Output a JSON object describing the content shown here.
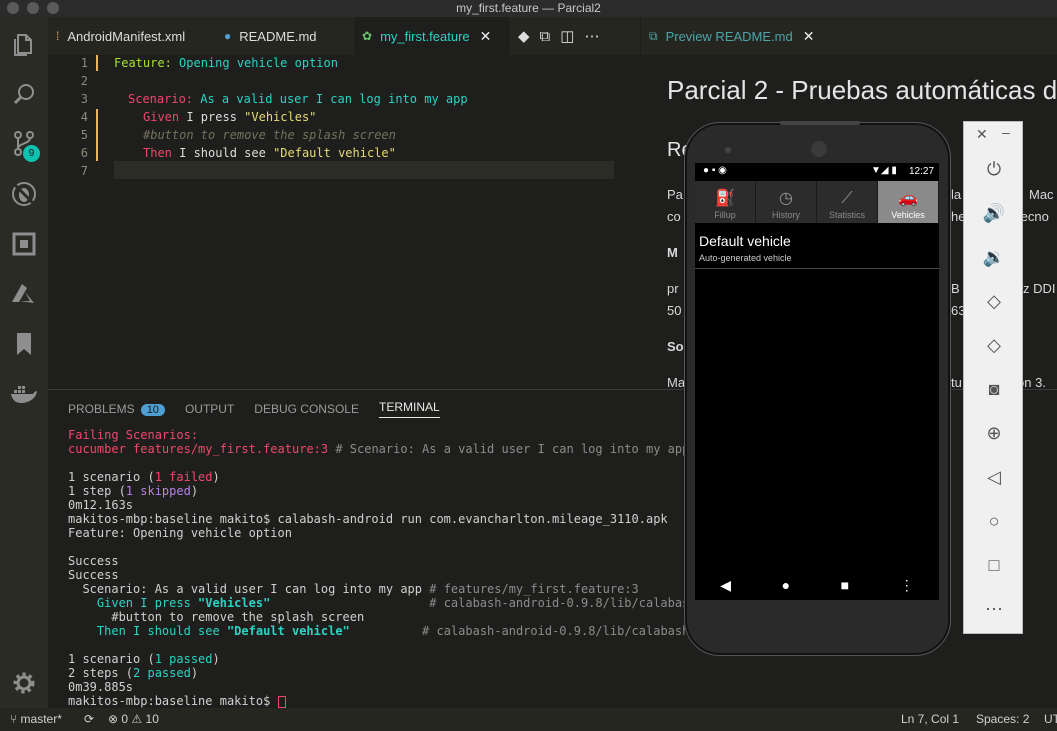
{
  "window": {
    "title": "my_first.feature — Parcial2"
  },
  "activity_bar": {
    "scm_badge": "9"
  },
  "tabs": [
    {
      "label": "AndroidManifest.xml"
    },
    {
      "label": "README.md"
    },
    {
      "label": "my_first.feature"
    }
  ],
  "preview_tab": {
    "label": "Preview README.md"
  },
  "editor": {
    "line_numbers": [
      "1",
      "2",
      "3",
      "4",
      "5",
      "6",
      "7"
    ],
    "lines": {
      "l1_kw": "Feature:",
      "l1_text": " Opening vehicle option",
      "l3_kw": "Scenario:",
      "l3_text": " As a valid user I can log into my app",
      "l4_kw": "Given",
      "l4_text": " I press ",
      "l4_str": "\"Vehicles\"",
      "l5_comment": "#button to remove the splash screen",
      "l6_kw": "Then",
      "l6_text": " I should see ",
      "l6_str": "\"Default vehicle\""
    }
  },
  "preview": {
    "h1": "Parcial 2 - Pruebas automáticas d",
    "h2": "Re",
    "p1a": "Pa",
    "p1b": "la",
    "p1c": "Mac",
    "p2a": "co",
    "p2b": "he",
    "p2c": "tecno",
    "m_head": "M",
    "pr": "pr",
    "b_dd": "B",
    "z_ddi": "z DDI",
    "n50": "50",
    "n63": "63",
    "so": "So",
    "ma": "Ma",
    "tu": "tu",
    "on3": "ón 3."
  },
  "panel": {
    "tabs": {
      "problems": "PROBLEMS",
      "problems_count": "10",
      "output": "OUTPUT",
      "debug_console": "DEBUG CONSOLE",
      "terminal": "TERMINAL"
    },
    "terminal": {
      "t1": "Failing Scenarios:",
      "t2a": "cucumber features/my_first.feature:3",
      "t2b": " # Scenario: As a valid user I can log into my app",
      "t4a": "1 scenario (",
      "t4b": "1 failed",
      "t4c": ")",
      "t5a": "1 step (",
      "t5b": "1 skipped",
      "t5c": ")",
      "t6": "0m12.163s",
      "t7": "makitos-mbp:baseline makito$ calabash-android run com.evancharlton.mileage_3110.apk",
      "t8": "Feature: Opening vehicle option",
      "t10": "Success",
      "t11": "Success",
      "t12a": "  Scenario: As a valid user I can log into my app",
      "t12b": " # features/my_first.feature:3",
      "t13a": "    Given I press ",
      "t13b": "\"Vehicles\"",
      "t13c": "                      # calabash-android-0.9.8/lib/calabash-",
      "t14": "      #button to remove the splash screen",
      "t15a": "    Then I should see ",
      "t15b": "\"Default vehicle\"",
      "t15c": "          # calabash-android-0.9.8/lib/calabash-",
      "t17a": "1 scenario (",
      "t17b": "1 passed",
      "t17c": ")",
      "t18a": "2 steps (",
      "t18b": "2 passed",
      "t18c": ")",
      "t19": "0m39.885s",
      "t20": "makitos-mbp:baseline makito$ "
    }
  },
  "status_bar": {
    "branch": "master*",
    "errors": "0",
    "warnings": "10",
    "position": "Ln 7, Col 1",
    "spaces": "Spaces: 2",
    "encoding": "UT"
  },
  "emulator": {
    "time": "12:27",
    "app_tabs": [
      {
        "label": "Fillup"
      },
      {
        "label": "History"
      },
      {
        "label": "Statistics"
      },
      {
        "label": "Vehicles"
      }
    ],
    "vehicle_title": "Default vehicle",
    "vehicle_subtitle": "Auto-generated vehicle"
  }
}
